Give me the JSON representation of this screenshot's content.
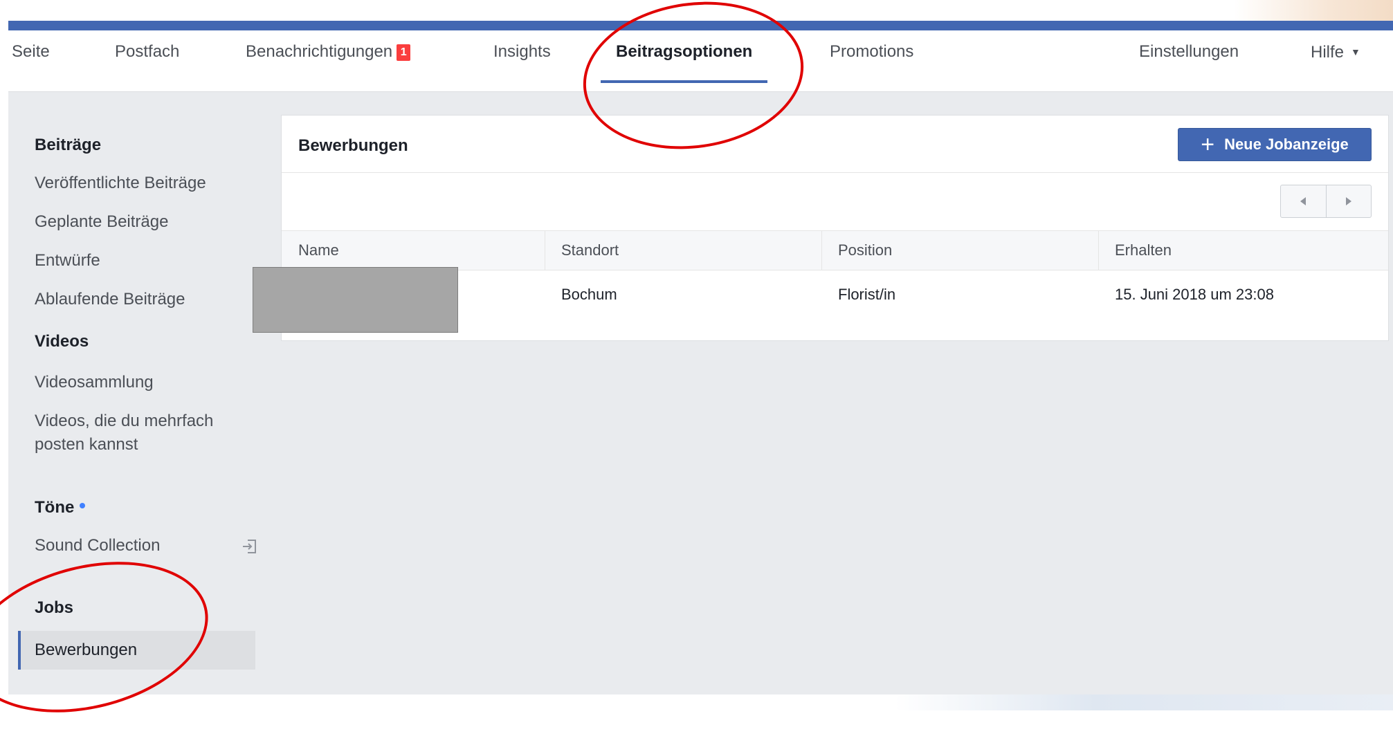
{
  "topnav": {
    "items": [
      {
        "label": "Seite"
      },
      {
        "label": "Postfach"
      },
      {
        "label": "Benachrichtigungen",
        "badge": "1"
      },
      {
        "label": "Insights"
      },
      {
        "label": "Beitragsoptionen",
        "active": true
      },
      {
        "label": "Promotions"
      },
      {
        "label": "Einstellungen"
      },
      {
        "label": "Hilfe"
      }
    ]
  },
  "sidebar": {
    "sections": [
      {
        "title": "Beiträge",
        "items": [
          "Veröffentlichte Beiträge",
          "Geplante Beiträge",
          "Entwürfe",
          "Ablaufende Beiträge"
        ]
      },
      {
        "title": "Videos",
        "items": [
          "Videosammlung",
          "Videos, die du mehrfach posten kannst"
        ]
      },
      {
        "title": "Töne",
        "items": [
          "Sound Collection"
        ]
      },
      {
        "title": "Jobs",
        "items": [
          "Bewerbungen"
        ],
        "active_item": "Bewerbungen"
      }
    ]
  },
  "main": {
    "title": "Bewerbungen",
    "new_button": "Neue Jobanzeige",
    "table": {
      "columns": [
        "Name",
        "Standort",
        "Position",
        "Erhalten"
      ],
      "rows": [
        {
          "name": "",
          "standort": "Bochum",
          "position": "Florist/in",
          "erhalten": "15. Juni 2018 um 23:08"
        }
      ]
    }
  },
  "colors": {
    "brand_blue": "#4267b2",
    "badge_red": "#fa3e3e",
    "annotation_red": "#e00000",
    "background_gray": "#e9ebee"
  },
  "icons": {
    "pager_prev": "triangle-left-icon",
    "pager_next": "triangle-right-icon",
    "external": "external-link-icon",
    "plus": "plus-icon",
    "dropdown": "caret-down-icon"
  }
}
